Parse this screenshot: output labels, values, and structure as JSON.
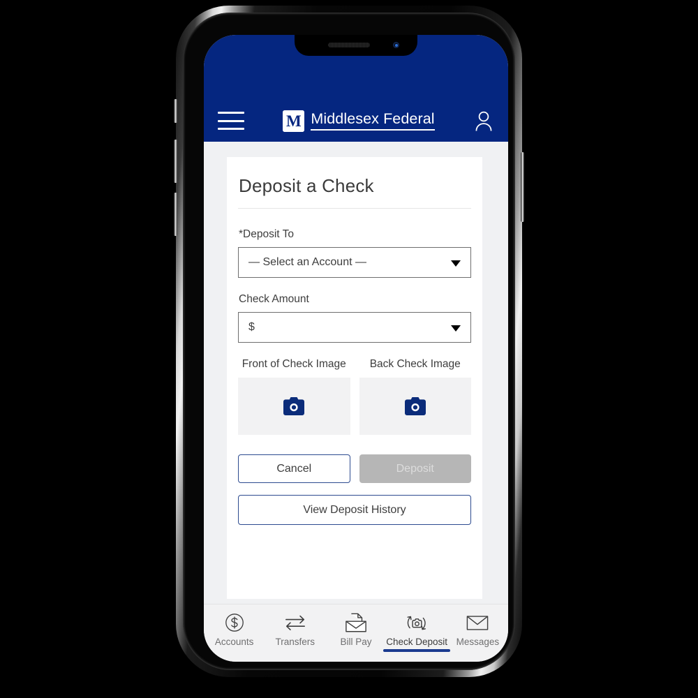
{
  "theme": {
    "navy": "#052680",
    "accent_underline": "#1a3a8f",
    "page_bg": "#f0f1f3",
    "card_bg": "#ffffff",
    "disabled_gray": "#b6b6b6"
  },
  "header": {
    "menu_icon": "hamburger-menu-icon",
    "brand_initial": "M",
    "brand_name": "Middlesex Federal",
    "profile_icon": "user-profile-icon"
  },
  "main": {
    "title": "Deposit a Check",
    "deposit_to": {
      "label": "*Deposit To",
      "value": "— Select an Account —",
      "caret_icon": "chevron-down-icon"
    },
    "check_amount": {
      "label": "Check Amount",
      "value": "$",
      "caret_icon": "chevron-down-icon"
    },
    "images": [
      {
        "caption": "Front of Check Image",
        "icon": "camera-icon"
      },
      {
        "caption": "Back Check Image",
        "icon": "camera-icon"
      }
    ],
    "buttons": {
      "cancel": "Cancel",
      "deposit": "Deposit",
      "history": "View Deposit History"
    }
  },
  "tabbar": {
    "items": [
      {
        "label": "Accounts",
        "icon": "dollar-circle-icon",
        "active": false
      },
      {
        "label": "Transfers",
        "icon": "transfer-arrows-icon",
        "active": false
      },
      {
        "label": "Bill Pay",
        "icon": "bill-envelope-icon",
        "active": false
      },
      {
        "label": "Check Deposit",
        "icon": "camera-refresh-icon",
        "active": true
      },
      {
        "label": "Messages",
        "icon": "envelope-icon",
        "active": false
      }
    ]
  }
}
